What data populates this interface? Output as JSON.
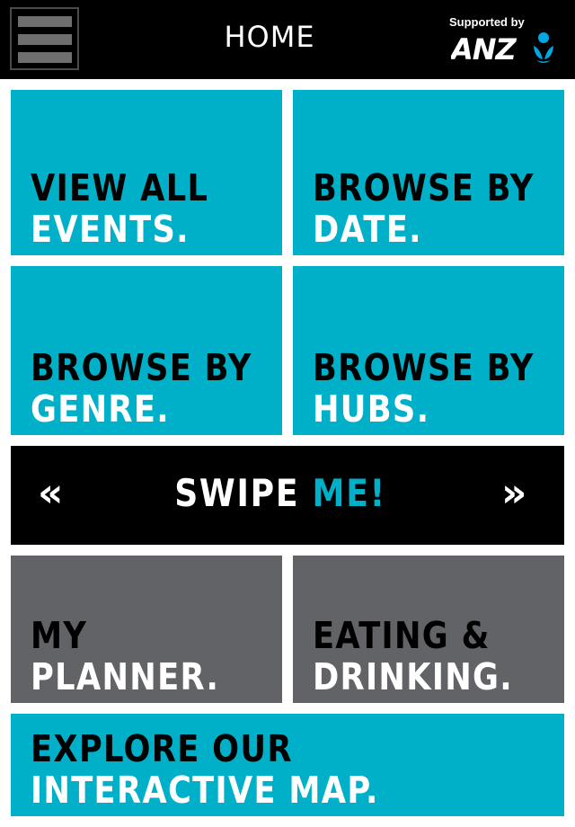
{
  "header": {
    "title": "HOME",
    "sponsor_prefix": "Supported by",
    "sponsor_logo_text": "ANZ"
  },
  "tiles": [
    {
      "line1": "VIEW ALL",
      "line2": "EVENTS."
    },
    {
      "line1": "BROWSE BY",
      "line2": "DATE."
    },
    {
      "line1": "BROWSE BY",
      "line2": "GENRE."
    },
    {
      "line1": "BROWSE BY",
      "line2": "HUBS."
    },
    {
      "line1": "MY",
      "line2": "PLANNER."
    },
    {
      "line1": "EATING &",
      "line2": "DRINKING."
    },
    {
      "line1": "EXPLORE OUR",
      "line2": "INTERACTIVE MAP."
    }
  ],
  "swipe": {
    "prev": "«",
    "word1": "SWIPE",
    "word2": "ME!",
    "next": "»"
  },
  "colors": {
    "brand_blue": "#00b0c8",
    "tile_grey": "#626366",
    "header_bg": "#000000"
  },
  "icons": {
    "menu": "hamburger-icon",
    "prev": "double-chevron-left-icon",
    "next": "double-chevron-right-icon"
  }
}
